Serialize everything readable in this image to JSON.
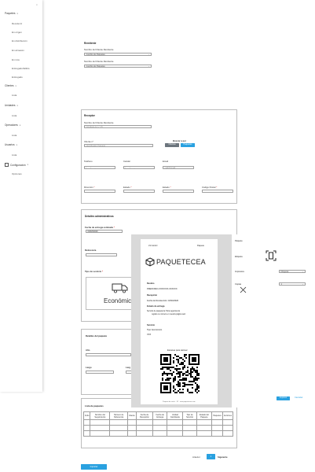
{
  "sidebar": {
    "close": "×",
    "sections": [
      {
        "label": "Paquetes",
        "items": [
          "Recoleccí",
          "En origen",
          "En distribución",
          "En almacén",
          "En ruta",
          "Entregado/fallido",
          "Entregado"
        ]
      },
      {
        "label": "Clientes",
        "items": [
          "Lista"
        ]
      },
      {
        "label": "Unidades",
        "items": [
          "Lista"
        ]
      },
      {
        "label": "Operadores",
        "items": [
          "Lista"
        ]
      },
      {
        "label": "Usuarios",
        "items": [
          "Lista"
        ]
      },
      {
        "label": "Configuración",
        "items": [
          "Opciones"
        ]
      }
    ]
  },
  "remitente": {
    "title": "Remitente",
    "label1": "Nombre del Cliente Remitente",
    "select1": "Cambio de Paquetes",
    "label2": "Nombre del Cliente Remitente",
    "select2": "Cambio de Paquetes"
  },
  "receptor": {
    "title": "Receptor",
    "nombre_label": "Nombre del Cliente Remitente",
    "nombre_placeholder": "Introduce tu n.º 15",
    "buscar_label": "Buscar a por",
    "cliente_label": "Cliente n°",
    "cliente_placeholder": "Identificador Paquete",
    "btn_clientes": "Clientes",
    "btn_paquetes": "Paquetes",
    "telefono_label": "Teléfono",
    "telefono_placeholder": "(___) ___-____",
    "celular_label": "Celular",
    "celular_placeholder": "(___) ___-____",
    "email_label": "Email",
    "email_placeholder": "mail@gmail",
    "direccion_label": "Dirección",
    "estado_label": "Estado",
    "estado2_label": "Estado",
    "cp_label": "Código Postal",
    "req": "*"
  },
  "admin": {
    "title": "Detalles administrativos",
    "fecha_label": "Fecha de entrega estimada",
    "fecha_value": "03/18/2020",
    "referencia_label": "Referencia",
    "servicio_label": "Tipo de servicio",
    "servicio_value": "Económico"
  },
  "paquete": {
    "title": "Detalles del paquete",
    "alto_label": "Alto",
    "largo_label": "Largo",
    "largo2_label": "Larg"
  },
  "lista": {
    "title": "Lista de paquetes",
    "headers": [
      "Folio",
      "Nombre del Seguimiento",
      "Número de Referencia",
      "Cliente",
      "Fecha de Recepción",
      "Fecha de Entrega",
      "Unidad Cambiante",
      "Tipo de Servicio",
      "Estado del Paquete",
      "Paquetes",
      "Acciones"
    ]
  },
  "pagination": {
    "prev": "Anterior",
    "page": "1",
    "next": "Siguiente"
  },
  "import_button": "Importar",
  "label_doc": {
    "header_left": "LS Control",
    "header_right": "Paquete",
    "brand": "PAQUETECEA",
    "lines": [
      "Destino",
      "PRESTAMO-XXXXXXX-XXXXXX",
      "Recepción",
      "Fecha de Recolección: 18/03/2020",
      "Estado de entrega",
      "Servicio de paquetería: Para seguimiento",
      "registre su número en nuestra página web",
      "Servicio",
      "Tipo: Económico",
      "XXX",
      "Escanea para rastrear"
    ],
    "footer": "Paquete de envío · 1/1 · www.paquetecea.com"
  },
  "side_dialog": {
    "title": "Paquete",
    "etiqueta_label": "Etiqueta",
    "impresora_label": "Impresora",
    "impresora_value": "Ninguna",
    "copias_label": "Copias",
    "copias_value": "1",
    "btn_print": "Imprimir",
    "btn_cancel": "Cancelar"
  },
  "colors": {
    "accent": "#2aa1e0",
    "grey_button": "#6c757d",
    "overlay": "#d9d9d9"
  }
}
